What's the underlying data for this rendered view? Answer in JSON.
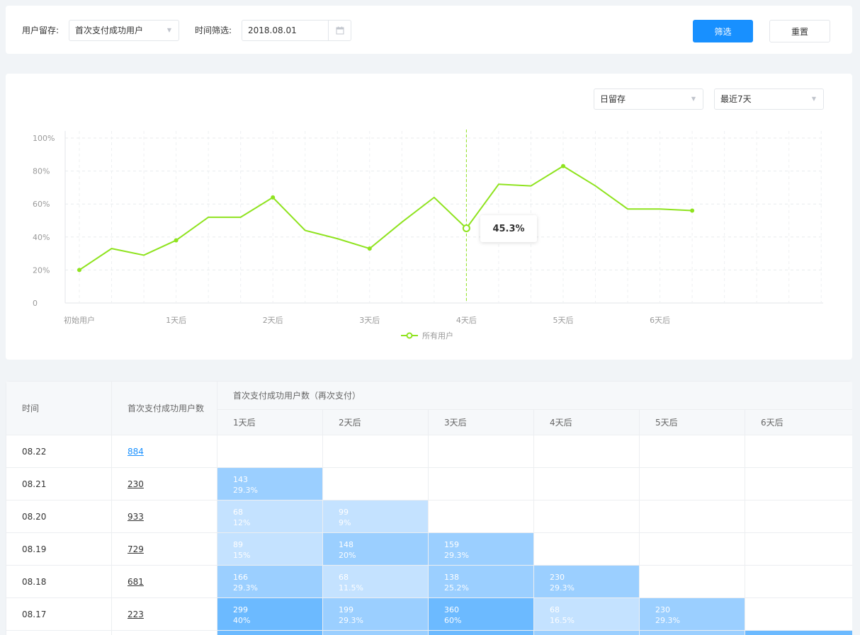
{
  "filter": {
    "retention_label": "用户留存:",
    "retention_value": "首次支付成功用户",
    "time_label": "时间筛选:",
    "date_value": "2018.08.01",
    "filter_button": "筛选",
    "reset_button": "重置"
  },
  "chart_controls": {
    "period_value": "日留存",
    "range_value": "最近7天"
  },
  "chart_data": {
    "type": "line",
    "y_ticks": [
      "0",
      "20%",
      "40%",
      "60%",
      "80%",
      "100%"
    ],
    "ylim": [
      0,
      100
    ],
    "x_labels": [
      "初始用户",
      "1天后",
      "2天后",
      "3天后",
      "4天后",
      "5天后",
      "6天后"
    ],
    "series": [
      {
        "name": "所有用户",
        "color": "#8fe31f",
        "values": [
          20,
          33,
          29,
          38,
          52,
          52,
          64,
          44,
          39,
          33,
          49,
          64,
          45.3,
          72,
          71,
          83,
          71,
          57,
          57,
          56
        ]
      }
    ],
    "highlight_index": 12,
    "tooltip": "45.3%"
  },
  "legend": {
    "label": "所有用户"
  },
  "table": {
    "col_time": "时间",
    "col_users": "首次支付成功用户数",
    "col_group": "首次支付成功用户数（再次支付）",
    "day_headers": [
      "1天后",
      "2天后",
      "3天后",
      "4天后",
      "5天后",
      "6天后"
    ],
    "rows": [
      {
        "date": "08.22",
        "users": "884",
        "highlight": true,
        "cells": []
      },
      {
        "date": "08.21",
        "users": "230",
        "cells": [
          {
            "n": "143",
            "p": "29.3%",
            "c": "#9bcfff"
          }
        ]
      },
      {
        "date": "08.20",
        "users": "933",
        "cells": [
          {
            "n": "68",
            "p": "12%",
            "c": "#c4e2ff"
          },
          {
            "n": "99",
            "p": "9%",
            "c": "#c4e2ff"
          }
        ]
      },
      {
        "date": "08.19",
        "users": "729",
        "cells": [
          {
            "n": "89",
            "p": "15%",
            "c": "#c4e2ff"
          },
          {
            "n": "148",
            "p": "20%",
            "c": "#9bcfff"
          },
          {
            "n": "159",
            "p": "29.3%",
            "c": "#9bcfff"
          }
        ]
      },
      {
        "date": "08.18",
        "users": "681",
        "cells": [
          {
            "n": "166",
            "p": "29.3%",
            "c": "#9bcfff"
          },
          {
            "n": "68",
            "p": "11.5%",
            "c": "#c4e2ff"
          },
          {
            "n": "138",
            "p": "25.2%",
            "c": "#9bcfff"
          },
          {
            "n": "230",
            "p": "29.3%",
            "c": "#9bcfff"
          }
        ]
      },
      {
        "date": "08.17",
        "users": "223",
        "cells": [
          {
            "n": "299",
            "p": "40%",
            "c": "#6cbaff"
          },
          {
            "n": "199",
            "p": "29.3%",
            "c": "#9bcfff"
          },
          {
            "n": "360",
            "p": "60%",
            "c": "#6cbaff"
          },
          {
            "n": "68",
            "p": "16.5%",
            "c": "#c4e2ff"
          },
          {
            "n": "230",
            "p": "29.3%",
            "c": "#9bcfff"
          }
        ]
      }
    ]
  }
}
